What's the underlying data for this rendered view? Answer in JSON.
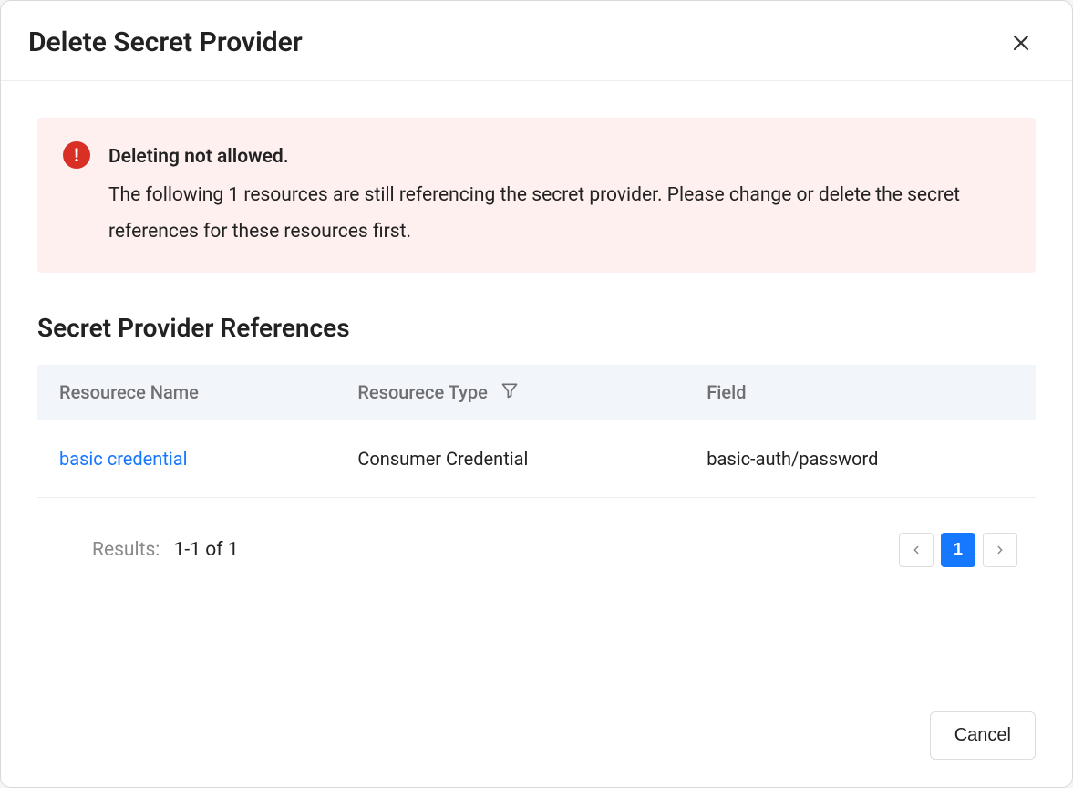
{
  "modal": {
    "title": "Delete Secret Provider"
  },
  "alert": {
    "heading": "Deleting not allowed.",
    "message": "The following 1 resources are still referencing the secret provider. Please change or delete the secret references for these resources first."
  },
  "section": {
    "title": "Secret Provider References"
  },
  "table": {
    "columns": {
      "name": "Resourece Name",
      "type": "Resourece Type",
      "field": "Field"
    },
    "rows": [
      {
        "name": "basic credential",
        "type": "Consumer Credential",
        "field": "basic-auth/password"
      }
    ]
  },
  "pagination": {
    "results_label": "Results:",
    "results_value": "1-1 of 1",
    "current_page": "1"
  },
  "footer": {
    "cancel": "Cancel"
  }
}
